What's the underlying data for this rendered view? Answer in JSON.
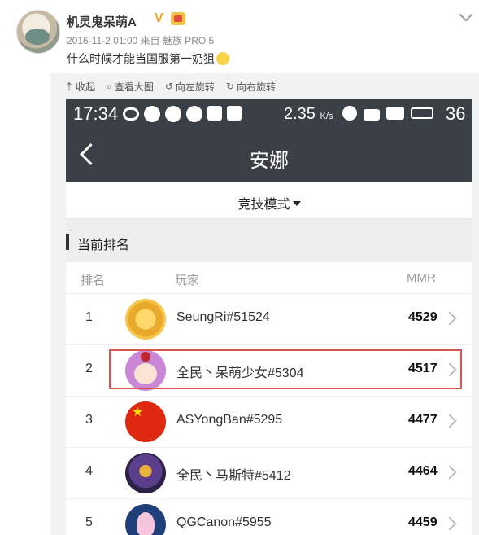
{
  "post": {
    "username": "机灵鬼呆萌A",
    "verified_mark": "V",
    "meta": "2016-11-2 01:00 来自 魅族 PRO 5",
    "text": "什么时候才能当国服第一奶狙"
  },
  "embed_toolbar": [
    {
      "icon": "⇡",
      "icon_name": "collapse-icon",
      "label": "收起"
    },
    {
      "icon": "⌕",
      "icon_name": "zoom-icon",
      "label": "查看大图"
    },
    {
      "icon": "↺",
      "icon_name": "rotate-left-icon",
      "label": "向左旋转"
    },
    {
      "icon": "↻",
      "icon_name": "rotate-right-icon",
      "label": "向右旋转"
    }
  ],
  "phone": {
    "status": {
      "time": "17:34",
      "net_speed": "2.35",
      "net_unit": "K/s",
      "battery": "36"
    },
    "nav_title": "安娜",
    "mode_label": "竞技模式",
    "section_title": "当前排名",
    "columns": {
      "rank": "排名",
      "player": "玩家",
      "mmr": "MMR"
    },
    "rows": [
      {
        "rank": "1",
        "name": "SeungRi#51524",
        "mmr": "4529",
        "avatar": "gold-emblem"
      },
      {
        "rank": "2",
        "name": "全民丶呆萌少女#5304",
        "mmr": "4517",
        "avatar": "girl"
      },
      {
        "rank": "3",
        "name": "ASYongBan#5295",
        "mmr": "4477",
        "avatar": "china-flag"
      },
      {
        "rank": "4",
        "name": "全民丶马斯特#5412",
        "mmr": "4464",
        "avatar": "dark-hero"
      },
      {
        "rank": "5",
        "name": "QGCanon#5955",
        "mmr": "4459",
        "avatar": "dva-bunny"
      }
    ]
  },
  "colors": {
    "status_bar": "#3a4046",
    "highlight": "#d9534f",
    "section_bg": "#eeeeee"
  }
}
